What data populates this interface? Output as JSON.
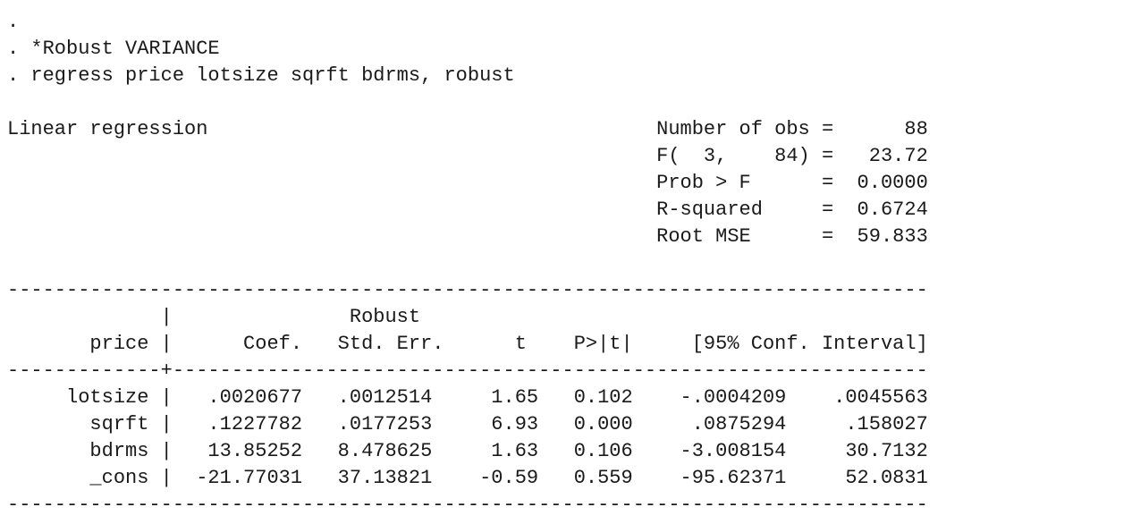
{
  "log": {
    "lines": [
      ".",
      ". *Robust VARIANCE",
      ". regress price lotsize sqrft bdrms, robust",
      "",
      "Linear regression                                      Number of obs =      88",
      "                                                       F(  3,    84) =   23.72",
      "                                                       Prob > F      =  0.0000",
      "                                                       R-squared     =  0.6724",
      "                                                       Root MSE      =  59.833",
      "",
      "------------------------------------------------------------------------------",
      "             |               Robust",
      "       price |      Coef.   Std. Err.      t    P>|t|     [95% Conf. Interval]",
      "-------------+----------------------------------------------------------------",
      "     lotsize |   .0020677   .0012514     1.65   0.102    -.0004209    .0045563",
      "       sqrft |   .1227782   .0177253     6.93   0.000     .0875294     .158027",
      "       bdrms |   13.85252   8.478625     1.63   0.106    -3.008154     30.7132",
      "       _cons |  -21.77031   37.13821    -0.59   0.559    -95.62371     52.0831",
      "------------------------------------------------------------------------------"
    ]
  }
}
